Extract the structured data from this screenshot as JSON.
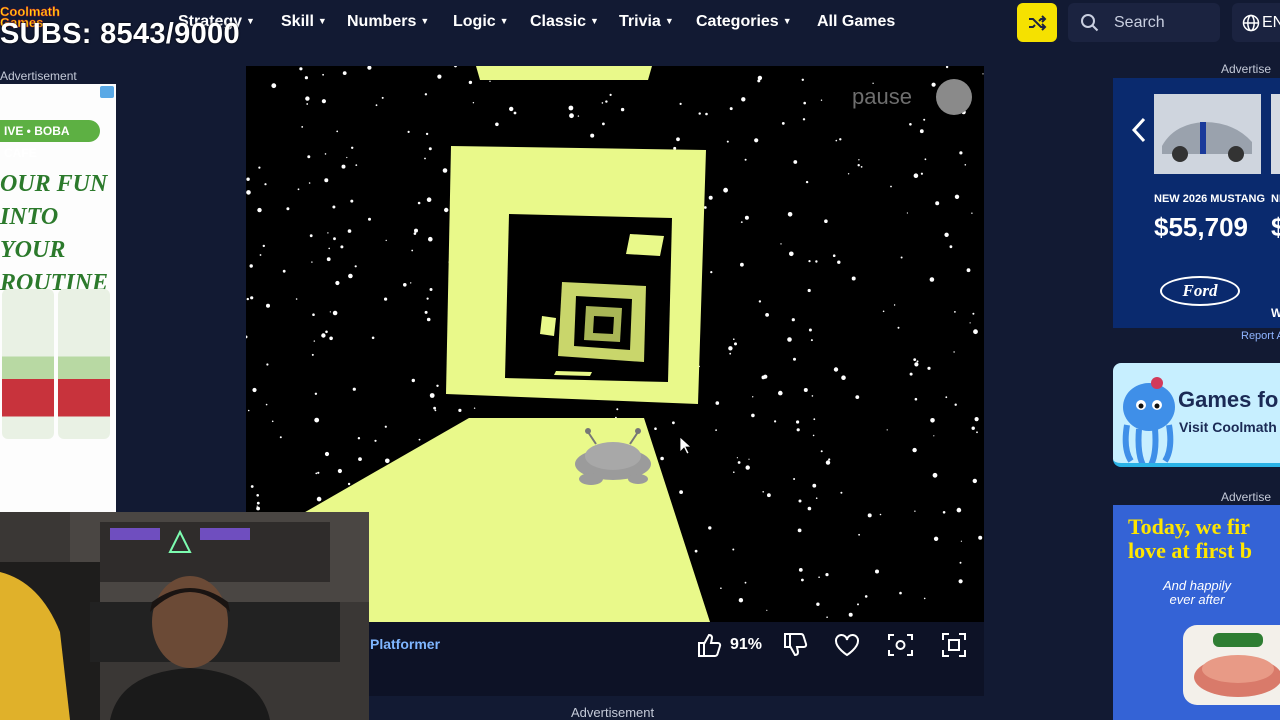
{
  "logo": {
    "line1": "Coolmath",
    "line2": "Games"
  },
  "overlay": {
    "subs": "SUBS: 8543/9000"
  },
  "nav": {
    "items": [
      {
        "label": "Strategy",
        "dropdown": true
      },
      {
        "label": "Skill",
        "dropdown": true
      },
      {
        "label": "Numbers",
        "dropdown": true
      },
      {
        "label": "Logic",
        "dropdown": true
      },
      {
        "label": "Classic",
        "dropdown": true
      },
      {
        "label": "Trivia",
        "dropdown": true
      },
      {
        "label": "Categories",
        "dropdown": true
      },
      {
        "label": "All Games",
        "dropdown": false
      }
    ],
    "search_label": "Search",
    "language": "EN",
    "shuffle_color": "#f5e100"
  },
  "ads": {
    "left_label": "Advertisement",
    "left_brand": "IVE • BOBA CAFE",
    "left_copy": [
      "OUR FUN",
      "INTO",
      "YOUR",
      "ROUTINE"
    ],
    "right_label_1": "Advertise",
    "right_model": "NEW 2026 MUSTANG",
    "right_price": "$55,709",
    "right_price_next": "$",
    "right_model_next": "NE",
    "right_extra": "W",
    "ford": "Ford",
    "report": "Report A",
    "right_promo_title": "Games fo",
    "right_promo_sub": "Visit Coolmath",
    "right_label_3": "Advertise",
    "right_ad3_head": [
      "Today, we fir",
      "love at first b"
    ],
    "right_ad3_small": [
      "And happily",
      "ever after"
    ],
    "bottom_label": "Advertisement"
  },
  "game": {
    "pause": "pause",
    "title": "Platformer",
    "like_pct": "91%",
    "tile_color": "#e9f98a"
  }
}
